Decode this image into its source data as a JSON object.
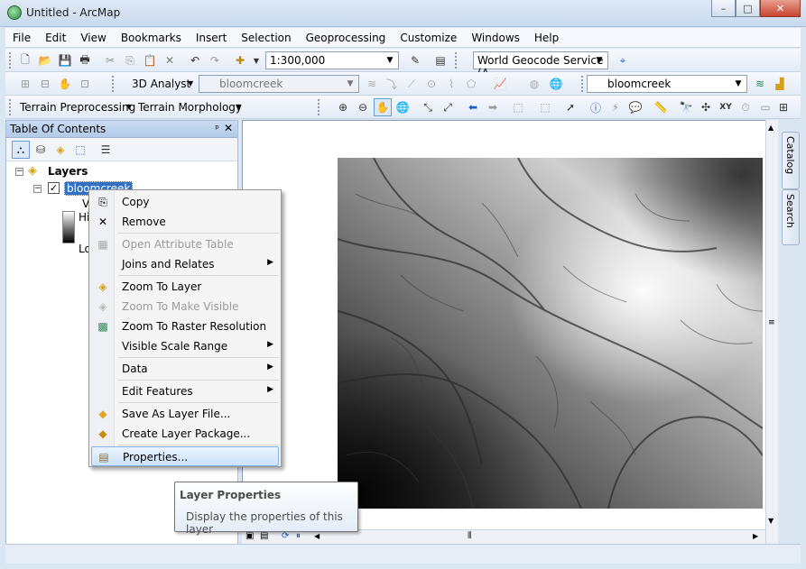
{
  "window": {
    "title": "Untitled - ArcMap",
    "min": "–",
    "max": "□",
    "close": "✕"
  },
  "menu": [
    "File",
    "Edit",
    "View",
    "Bookmarks",
    "Insert",
    "Selection",
    "Geoprocessing",
    "Customize",
    "Windows",
    "Help"
  ],
  "toolbar": {
    "scale": "1:300,000",
    "geocode_service": "World Geocode Service (A",
    "analyst_label": "3D Analyst",
    "layer_combo_disabled": "bloomcreek",
    "layer_combo": "bloomcreek",
    "terrain_preprocessing": "Terrain Preprocessing",
    "terrain_morphology": "Terrain Morphology"
  },
  "toc": {
    "title": "Table Of Contents",
    "pin": "ᵖ",
    "close": "✕",
    "group": "Layers",
    "layer": "bloomcreek",
    "legend_value_label": "V",
    "legend_high": "Hi",
    "legend_low": "Lo"
  },
  "context_menu": {
    "items": [
      {
        "label": "Copy",
        "icon": "copy-icon"
      },
      {
        "label": "Remove",
        "icon": "remove-icon"
      },
      {
        "label": "Open Attribute Table",
        "icon": "table-icon"
      },
      {
        "label": "Joins and Relates",
        "icon": ""
      },
      {
        "label": "Zoom To Layer",
        "icon": "zoom-layer-icon"
      },
      {
        "label": "Zoom To Make Visible",
        "icon": "zoom-visible-icon"
      },
      {
        "label": "Zoom To Raster Resolution",
        "icon": "raster-resolution-icon"
      },
      {
        "label": "Visible Scale Range",
        "icon": ""
      },
      {
        "label": "Data",
        "icon": ""
      },
      {
        "label": "Edit Features",
        "icon": ""
      },
      {
        "label": "Save As Layer File...",
        "icon": "layer-file-icon"
      },
      {
        "label": "Create Layer Package...",
        "icon": "layer-package-icon"
      },
      {
        "label": "Properties...",
        "icon": "properties-icon"
      }
    ]
  },
  "tooltip": {
    "title": "Layer Properties",
    "text": "Display the properties of this layer"
  },
  "side_tabs": {
    "catalog": "Catalog",
    "search": "Search"
  },
  "colors": {
    "selection": "#3071c6",
    "hover_border": "#7fb1e6"
  }
}
